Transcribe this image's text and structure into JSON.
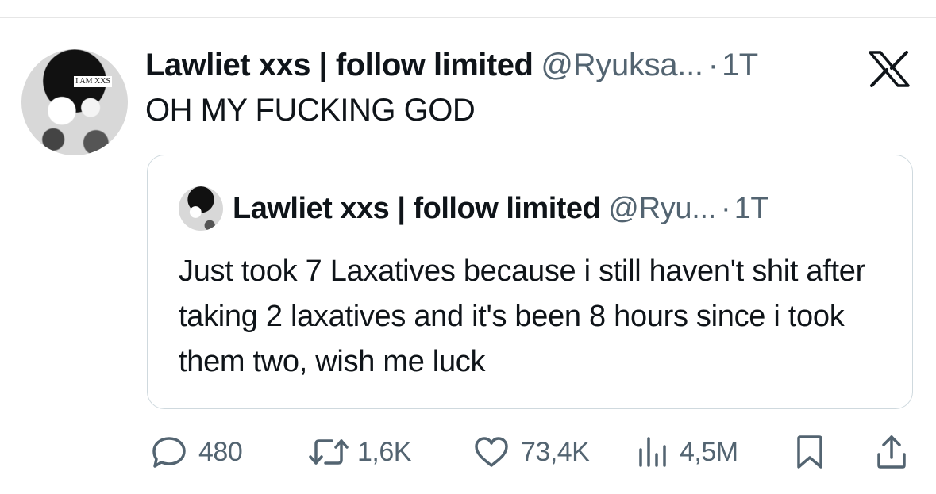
{
  "tweet": {
    "author_name": "Lawliet xxs | follow limited",
    "handle": "@Ryuksa...",
    "separator": "·",
    "time": "1T",
    "avatar_text": "I AM XXS",
    "text": "OH MY FUCKING GOD"
  },
  "quoted_tweet": {
    "author_name": "Lawliet xxs | follow limited",
    "handle": "@Ryu...",
    "separator": "·",
    "time": "1T",
    "text": "Just took 7 Laxatives because i still haven't shit after taking 2 laxatives and it's been 8 hours since i took them two, wish me luck"
  },
  "actions": {
    "replies": "480",
    "reposts": "1,6K",
    "likes": "73,4K",
    "views": "4,5M"
  },
  "icons": {
    "brand": "x-logo-icon",
    "reply": "reply-bubble-icon",
    "repost": "repost-arrows-icon",
    "like": "heart-icon",
    "views": "views-bar-chart-icon",
    "bookmark": "bookmark-icon",
    "share": "share-upload-icon"
  },
  "colors": {
    "text_primary": "#0f1419",
    "text_secondary": "#536471",
    "border": "#cfd9de"
  }
}
